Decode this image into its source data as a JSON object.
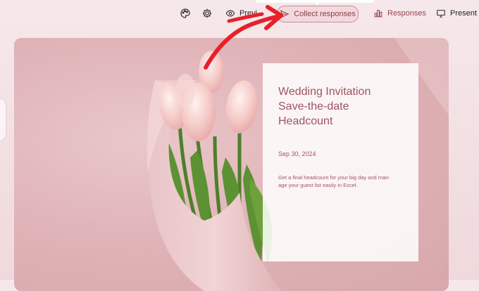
{
  "toolbar": {
    "theme_icon": "palette-icon",
    "settings_icon": "gear-icon",
    "preview_label": "Previ",
    "collect_label": "Collect responses",
    "responses_label": "Responses",
    "present_label": "Present"
  },
  "form": {
    "title_lines": [
      "Wedding Invitation",
      "Save-the-date",
      "Headcount"
    ],
    "date": "Sep 30, 2024",
    "description_lines": [
      "Get a final headcount for your big day and man-",
      "age your guest list easily in Excel."
    ]
  },
  "colors": {
    "accent": "#9e5560",
    "collect_border": "#c98c96",
    "arrow": "#e8202a"
  }
}
